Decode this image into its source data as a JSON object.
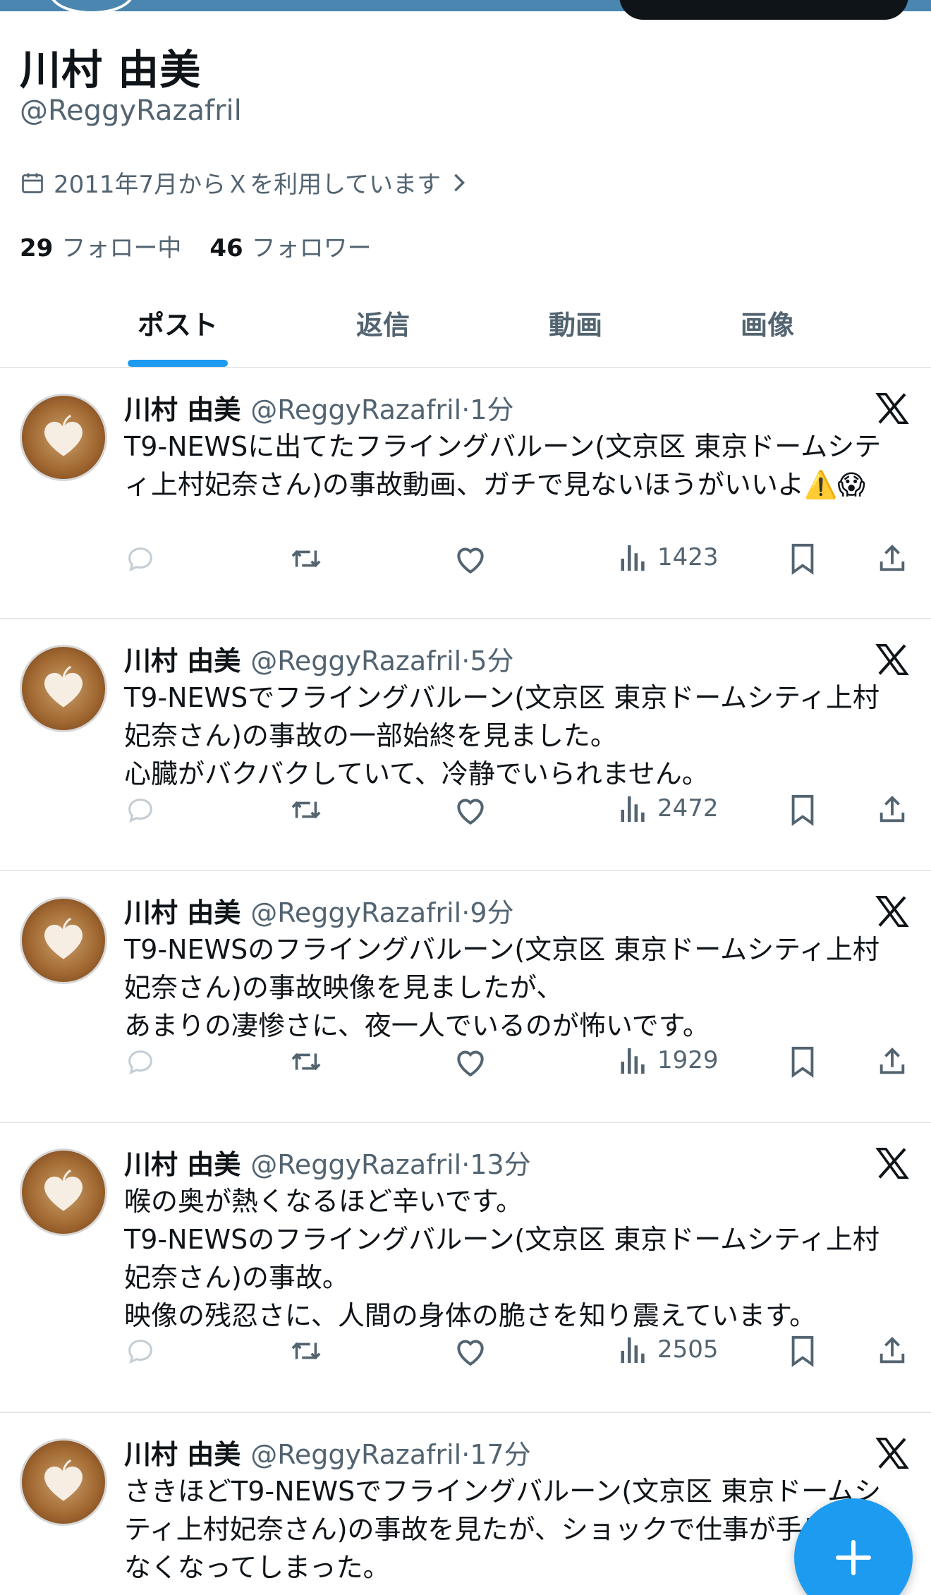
{
  "profile": {
    "name": "川村 由美",
    "handle": "@ReggyRazafril",
    "joined": "2011年7月からＸを利用しています",
    "following_count": "29",
    "following_label": "フォロー中",
    "followers_count": "46",
    "followers_label": "フォロワー"
  },
  "tabs": [
    {
      "label": "ポスト",
      "active": true
    },
    {
      "label": "返信",
      "active": false
    },
    {
      "label": "動画",
      "active": false
    },
    {
      "label": "画像",
      "active": false
    }
  ],
  "posts": [
    {
      "name": "川村 由美",
      "handle": "@ReggyRazafril",
      "time": "·1分",
      "text": "T9-NEWSに出てたフライングバルーン(文京区 東京ドームシティ上村妃奈さん)の事故動画、ガチで見ないほうがいいよ⚠️😱",
      "views": "1423"
    },
    {
      "name": "川村 由美",
      "handle": "@ReggyRazafril",
      "time": "·5分",
      "text": "T9-NEWSでフライングバルーン(文京区 東京ドームシティ上村妃奈さん)の事故の一部始終を見ました。\n心臓がバクバクしていて、冷静でいられません。",
      "views": "2472"
    },
    {
      "name": "川村 由美",
      "handle": "@ReggyRazafril",
      "time": "·9分",
      "text": "T9-NEWSのフライングバルーン(文京区 東京ドームシティ上村妃奈さん)の事故映像を見ましたが、\nあまりの凄惨さに、夜一人でいるのが怖いです。",
      "views": "1929"
    },
    {
      "name": "川村 由美",
      "handle": "@ReggyRazafril",
      "time": "·13分",
      "text": "喉の奥が熱くなるほど辛いです。\nT9-NEWSのフライングバルーン(文京区 東京ドームシティ上村妃奈さん)の事故。\n映像の残忍さに、人間の身体の脆さを知り震えています。",
      "views": "2505"
    },
    {
      "name": "川村 由美",
      "handle": "@ReggyRazafril",
      "time": "·17分",
      "text": "さきほどT9-NEWSでフライングバルーン(文京区 東京ドームシティ上村妃奈さん)の事故を見たが、ショックで仕事が手につかなくなってしまった。",
      "views": ""
    }
  ],
  "icons": {
    "calendar": "calendar-icon",
    "reply": "reply-icon",
    "repost": "repost-icon",
    "like": "heart-icon",
    "views": "views-icon",
    "bookmark": "bookmark-icon",
    "share": "share-icon",
    "x_logo": "x-logo-icon",
    "compose": "plus-icon"
  },
  "colors": {
    "accent": "#1d9bf0",
    "text": "#0f1419",
    "secondary": "#536471",
    "divider": "#e6e9eb"
  }
}
